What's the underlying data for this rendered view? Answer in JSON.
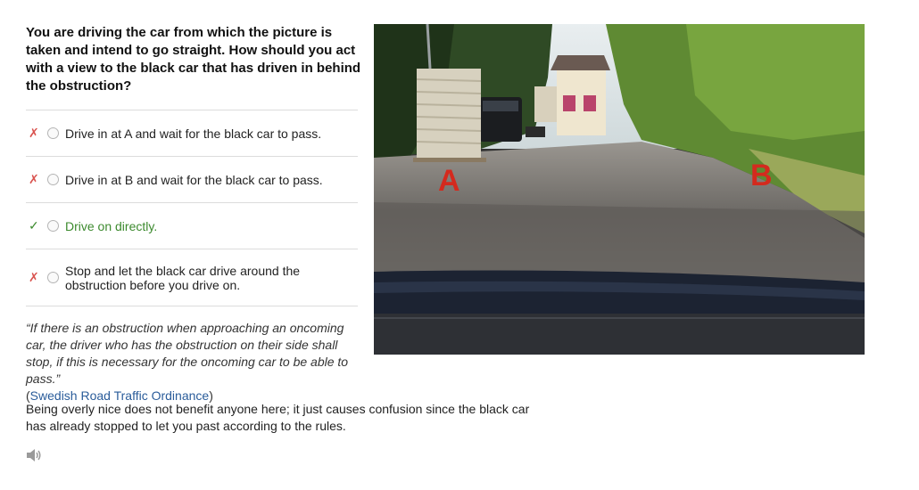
{
  "question": "You are driving the car from which the picture is taken and intend to go straight. How should you act with a view to the black car that has driven in behind the obstruction?",
  "answers": [
    {
      "mark": "✗",
      "label": "Drive in at A and wait for the black car to pass.",
      "correct": false
    },
    {
      "mark": "✗",
      "label": "Drive in at B and wait for the black car to pass.",
      "correct": false
    },
    {
      "mark": "✓",
      "label": "Drive on directly.",
      "correct": true
    },
    {
      "mark": "✗",
      "label": "Stop and let the black car drive around the obstruction before you drive on.",
      "correct": false
    }
  ],
  "quote": {
    "text": "“If there is an obstruction when approaching an oncoming car, the driver who has the obstruction on their side shall stop, if this is necessary for the oncoming car to be able to pass.”",
    "source_open": "(",
    "source": "Swedish Road Traffic Ordinance",
    "source_close": ")"
  },
  "explanation": "Being overly nice does not benefit anyone here; it just causes confusion since the black car has already stopped to let you past according to the rules.",
  "photo": {
    "label_a": "A",
    "label_b": "B"
  },
  "icons": {
    "audio": "speaker-icon",
    "wrong": "cross-icon",
    "right": "check-icon"
  },
  "colors": {
    "correct": "#3c8a2e",
    "wrong": "#d9534f",
    "link": "#2a5c9a",
    "marker": "#d42a1e"
  }
}
